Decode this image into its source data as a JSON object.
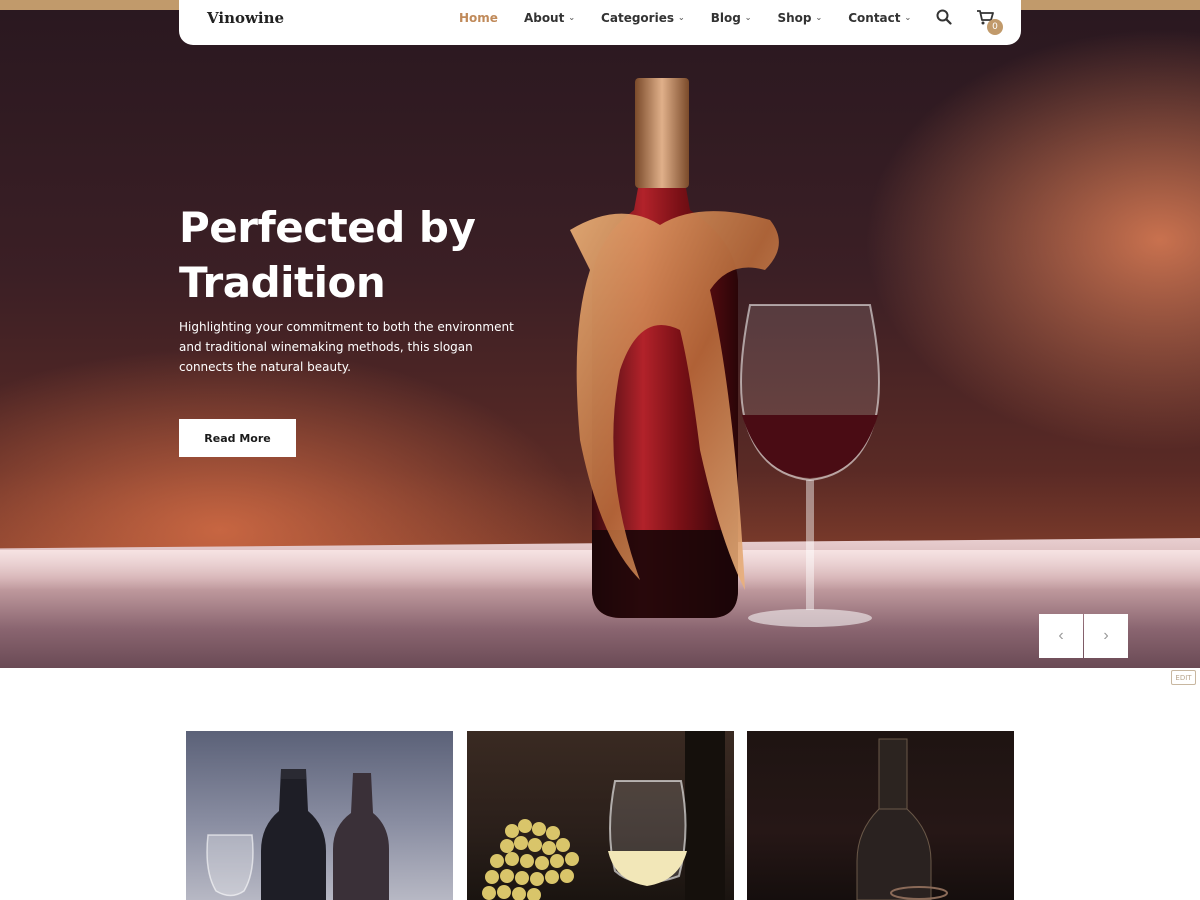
{
  "brand": {
    "logo_text": "Vinowine",
    "accent_color": "#c19a6b"
  },
  "nav": {
    "items": [
      {
        "label": "Home",
        "active": true,
        "has_dropdown": false
      },
      {
        "label": "About",
        "active": false,
        "has_dropdown": true
      },
      {
        "label": "Categories",
        "active": false,
        "has_dropdown": true
      },
      {
        "label": "Blog",
        "active": false,
        "has_dropdown": true
      },
      {
        "label": "Shop",
        "active": false,
        "has_dropdown": true
      },
      {
        "label": "Contact",
        "active": false,
        "has_dropdown": true
      }
    ],
    "search_icon": "search-icon",
    "cart_icon": "cart-icon",
    "cart_count": "0"
  },
  "hero": {
    "title_line1": "Perfected by",
    "title_line2": "Tradition",
    "description": "Highlighting your commitment to both the environment and traditional winemaking methods, this slogan connects the natural beauty.",
    "cta_label": "Read More",
    "prev_icon": "chevron-left-icon",
    "next_icon": "chevron-right-icon",
    "prev_glyph": "‹",
    "next_glyph": "›"
  },
  "edit_badge": "EDIT",
  "cards": [
    {
      "image": "wine-bottles-and-glass-photo"
    },
    {
      "image": "white-wine-and-grapes-photo"
    },
    {
      "image": "dark-wine-bottle-photo"
    }
  ]
}
